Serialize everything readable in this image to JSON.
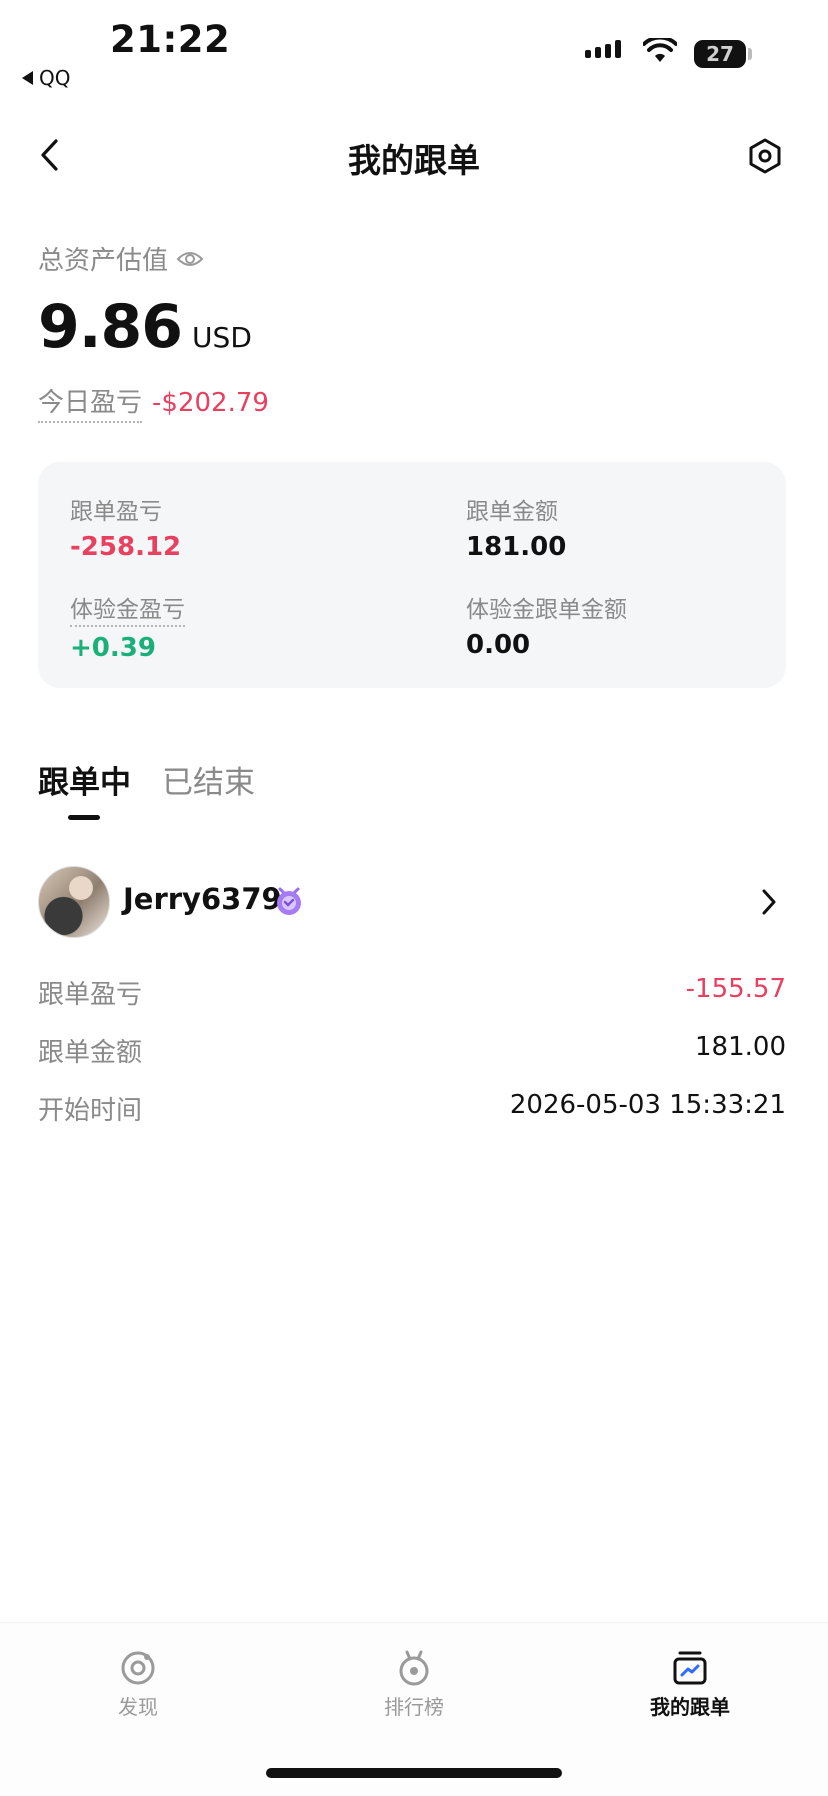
{
  "status_bar": {
    "time": "21:22",
    "back_app": "QQ",
    "battery": "27"
  },
  "nav": {
    "title": "我的跟单"
  },
  "asset": {
    "label": "总资产估值",
    "value": "9.86",
    "currency": "USD",
    "today_label": "今日盈亏",
    "today_value": "-$202.79"
  },
  "summary": {
    "follow_pnl_label": "跟单盈亏",
    "follow_pnl_value": "-258.12",
    "follow_amount_label": "跟单金额",
    "follow_amount_value": "181.00",
    "trial_pnl_label": "体验金盈亏",
    "trial_pnl_value": "+0.39",
    "trial_amount_label": "体验金跟单金额",
    "trial_amount_value": "0.00"
  },
  "tabs": {
    "active": "跟单中",
    "inactive": "已结束"
  },
  "follow_item": {
    "trader_name": "Jerry6379",
    "rows": [
      {
        "label": "跟单盈亏",
        "value": "-155.57"
      },
      {
        "label": "跟单金额",
        "value": "181.00"
      },
      {
        "label": "开始时间",
        "value": "2026-05-03 15:33:21"
      }
    ]
  },
  "tabbar": {
    "discover": "发现",
    "ranking": "排行榜",
    "my_follow": "我的跟单"
  },
  "colors": {
    "loss": "#e8405f",
    "gain": "#1bb07a",
    "badge": "#9b6cf0"
  },
  "icons": [
    "eye-icon",
    "back-chevron-icon",
    "settings-hex-icon",
    "vip-badge-icon",
    "chevron-right-icon",
    "discover-icon",
    "ranking-medal-icon",
    "my-follow-icon"
  ]
}
